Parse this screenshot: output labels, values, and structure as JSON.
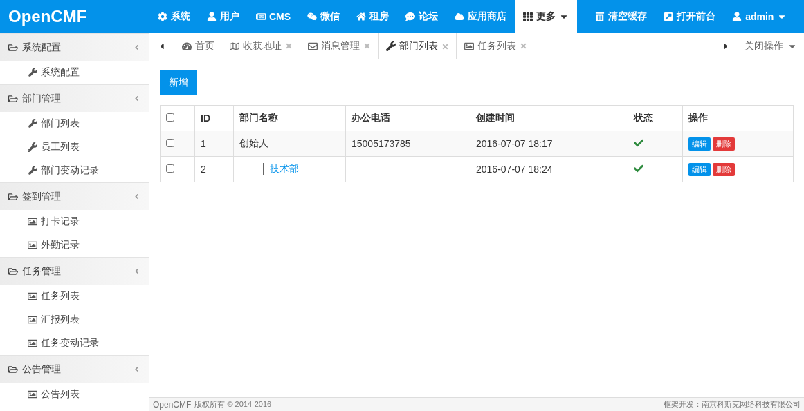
{
  "brand": "OpenCMF",
  "nav": [
    {
      "label": "系统",
      "selected": false,
      "dropdown": false
    },
    {
      "label": "用户",
      "selected": false,
      "dropdown": false
    },
    {
      "label": "CMS",
      "selected": false,
      "dropdown": false
    },
    {
      "label": "微信",
      "selected": false,
      "dropdown": false
    },
    {
      "label": "租房",
      "selected": false,
      "dropdown": false
    },
    {
      "label": "论坛",
      "selected": false,
      "dropdown": false
    },
    {
      "label": "应用商店",
      "selected": false,
      "dropdown": false
    },
    {
      "label": "更多",
      "selected": true,
      "dropdown": true
    }
  ],
  "nav_right": [
    {
      "label": "清空缓存",
      "dropdown": false
    },
    {
      "label": "打开前台",
      "dropdown": false
    },
    {
      "label": "admin",
      "dropdown": true
    }
  ],
  "sidebar": [
    {
      "label": "系统配置",
      "expanded": true,
      "children": [
        {
          "label": "系统配置",
          "kind": "tool"
        }
      ]
    },
    {
      "label": "部门管理",
      "expanded": true,
      "children": [
        {
          "label": "部门列表",
          "kind": "tool"
        },
        {
          "label": "员工列表",
          "kind": "tool"
        },
        {
          "label": "部门变动记录",
          "kind": "tool"
        }
      ]
    },
    {
      "label": "签到管理",
      "expanded": true,
      "children": [
        {
          "label": "打卡记录",
          "kind": "image"
        },
        {
          "label": "外勤记录",
          "kind": "image"
        }
      ]
    },
    {
      "label": "任务管理",
      "expanded": true,
      "children": [
        {
          "label": "任务列表",
          "kind": "image"
        },
        {
          "label": "汇报列表",
          "kind": "image"
        },
        {
          "label": "任务变动记录",
          "kind": "image"
        }
      ]
    },
    {
      "label": "公告管理",
      "expanded": true,
      "children": [
        {
          "label": "公告列表",
          "kind": "image"
        }
      ]
    }
  ],
  "tabs": [
    {
      "label": "首页",
      "selected": false,
      "closable": false
    },
    {
      "label": "收获地址",
      "selected": false,
      "closable": true
    },
    {
      "label": "消息管理",
      "selected": false,
      "closable": true
    },
    {
      "label": "部门列表",
      "selected": true,
      "closable": true
    },
    {
      "label": "任务列表",
      "selected": false,
      "closable": true
    }
  ],
  "tab_menu": "关闭操作",
  "add_button": "新增",
  "table": {
    "select_all_checked": false,
    "columns": [
      "ID",
      "部门名称",
      "办公电话",
      "创建时间",
      "状态",
      "操作"
    ],
    "rows": [
      {
        "checked": false,
        "id": "1",
        "name": "创始人",
        "kind": "root",
        "phone": "15005173785",
        "created": "2016-07-07 18:17",
        "enabled": true,
        "actions": [
          "编辑",
          "删除"
        ]
      },
      {
        "checked": false,
        "id": "2",
        "name": "技术部",
        "kind": "child",
        "branch": "├",
        "created": "2016-07-07 18:24",
        "enabled": true,
        "actions": [
          "编辑",
          "删除"
        ]
      }
    ]
  },
  "footer": {
    "left": "OpenCMF",
    "copyright": "版权所有 © 2014-2016",
    "right": "框架开发：南京科斯克网络科技有限公司"
  }
}
